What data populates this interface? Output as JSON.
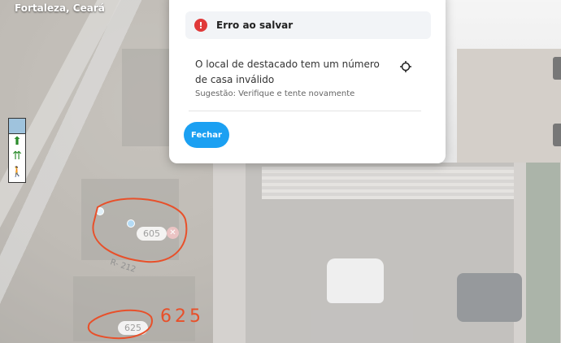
{
  "location": {
    "label": "Fortaleza, Ceará"
  },
  "map": {
    "markers": [
      {
        "label": "605"
      },
      {
        "label": "625"
      }
    ],
    "street_label": "R- 212"
  },
  "annotations": {
    "handwritten_number": "625"
  },
  "modal": {
    "alert_title": "Erro ao salvar",
    "message": "O local de destacado tem um número de casa inválido",
    "suggestion": "Sugestão: Verifique e tente novamente",
    "close_label": "Fechar"
  },
  "colors": {
    "accent": "#1ba0f2",
    "error": "#e03939",
    "annotation": "#e8502a"
  }
}
